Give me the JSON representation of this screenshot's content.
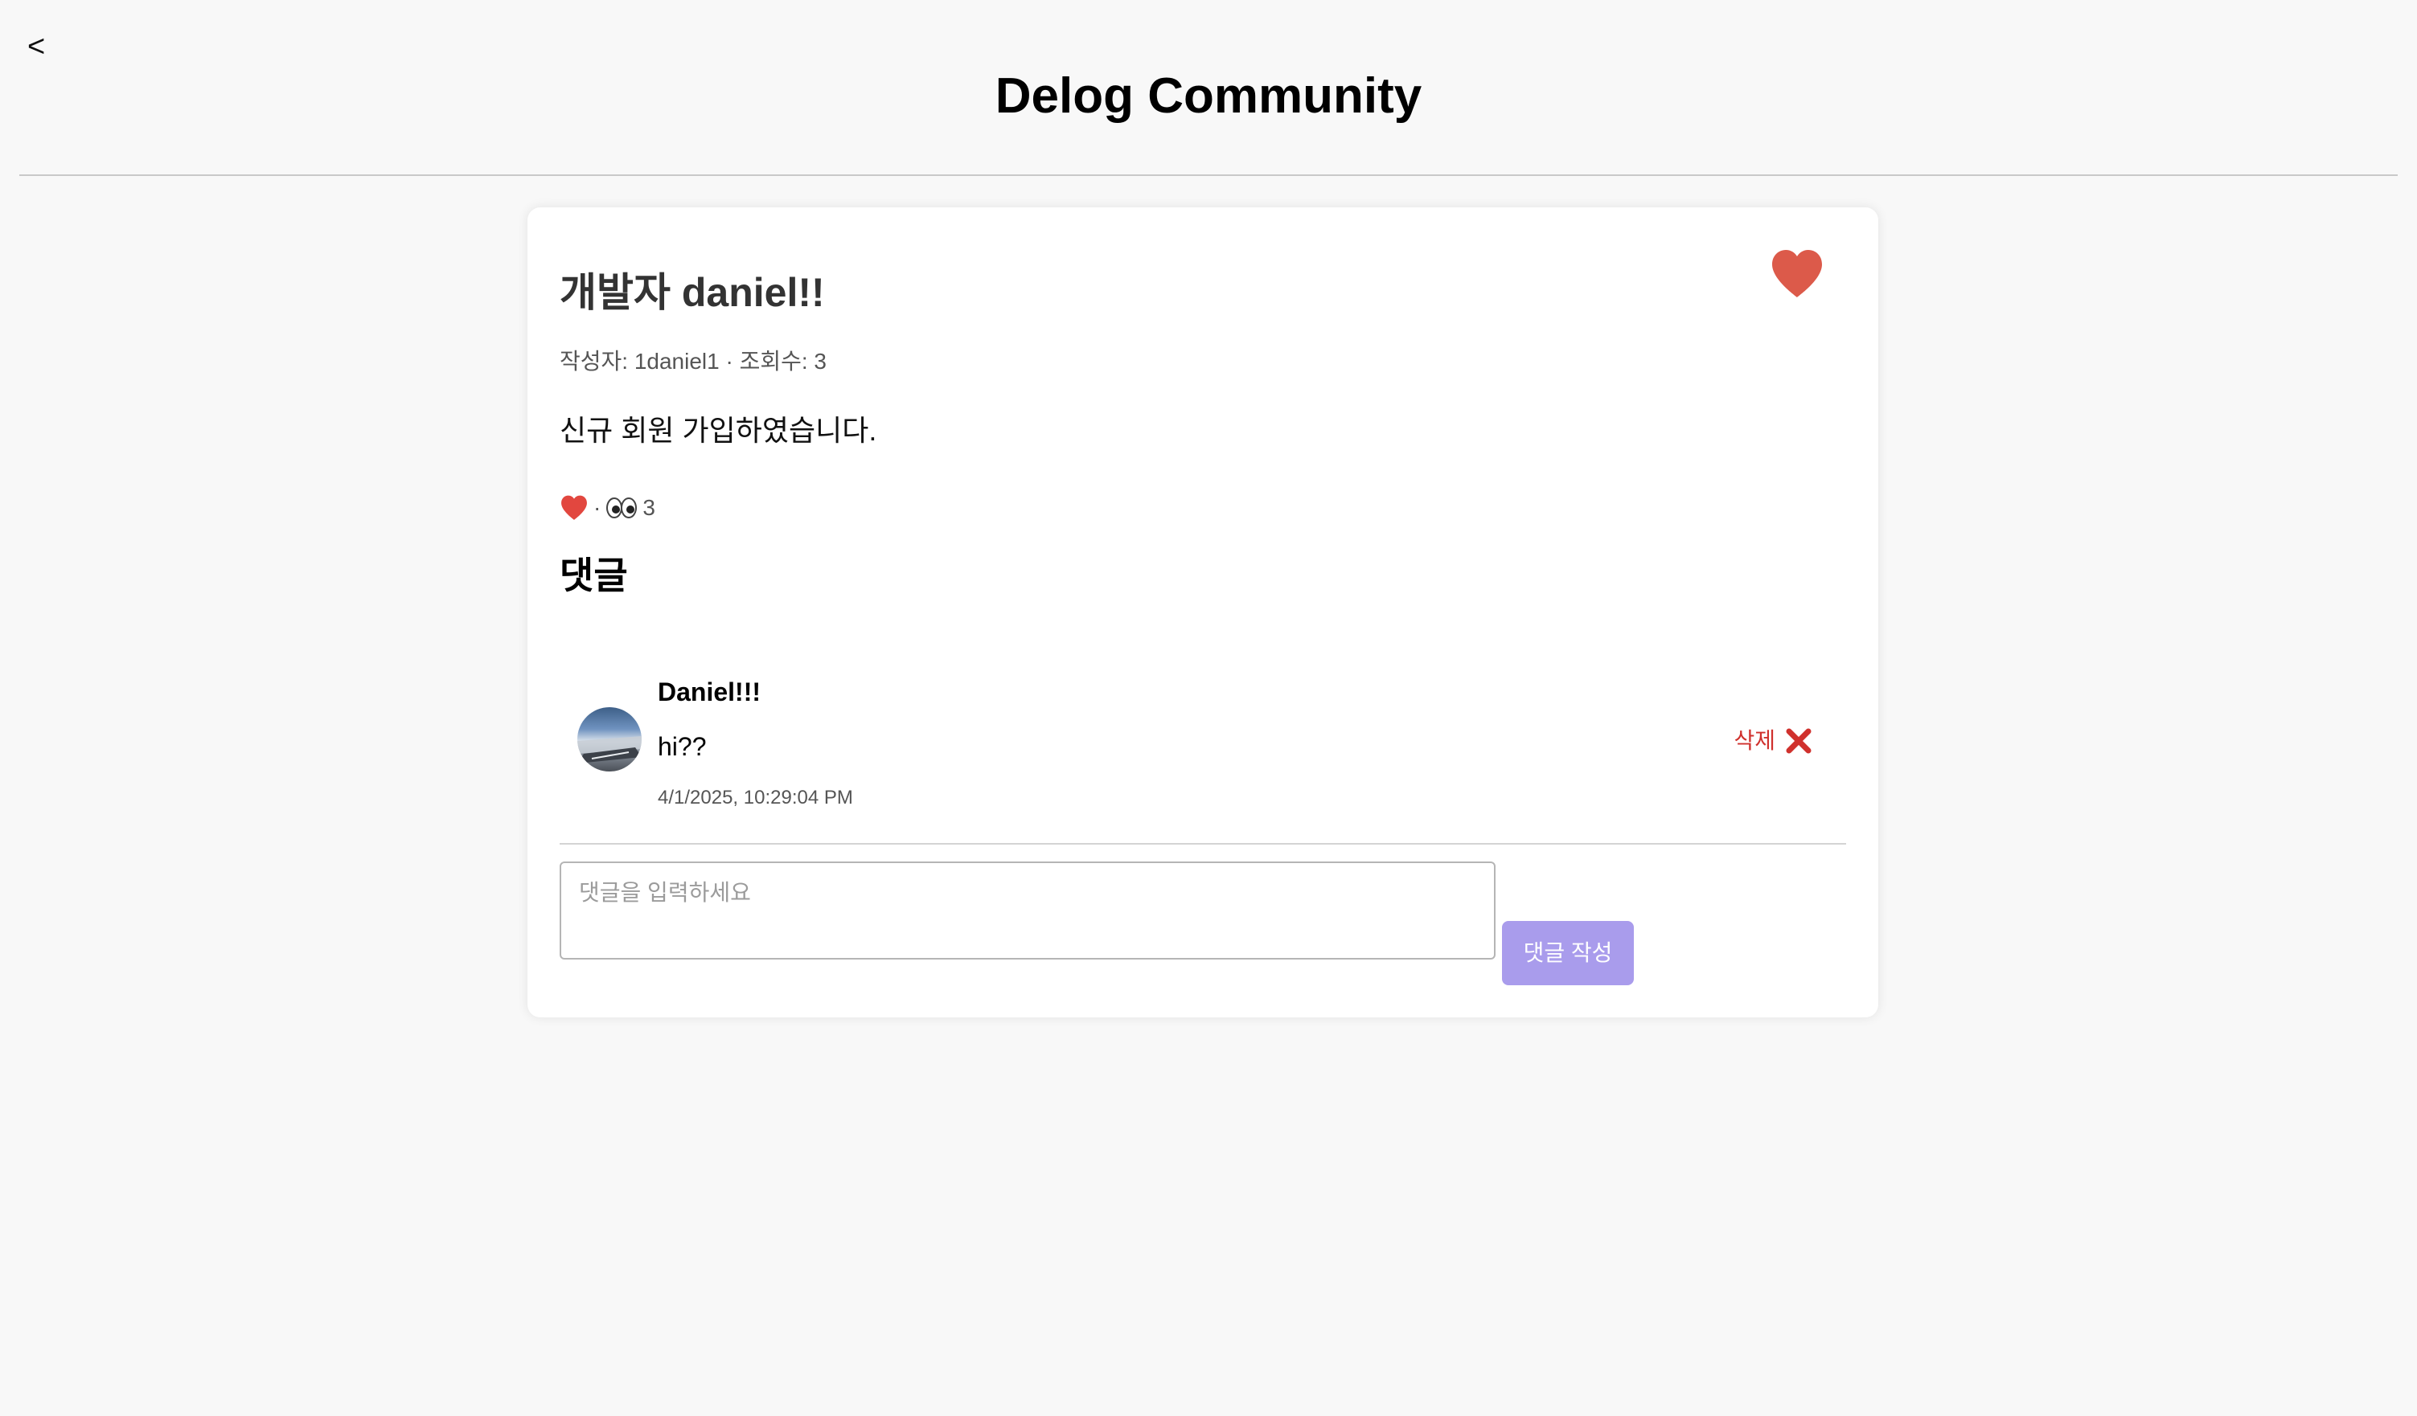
{
  "header": {
    "back_label": "<",
    "title": "Delog Community"
  },
  "post": {
    "title": "개발자 daniel!!",
    "meta": "작성자: 1daniel1 · 조회수: 3",
    "body": "신규 회원 가입하였습니다.",
    "stats": {
      "separator": "·",
      "views": "3"
    },
    "liked": true
  },
  "comments": {
    "heading": "댓글",
    "items": [
      {
        "author": "Daniel!!!",
        "text": "hi??",
        "timestamp": "4/1/2025, 10:29:04 PM",
        "delete_label": "삭제"
      }
    ],
    "input": {
      "placeholder": "댓글을 입력하세요",
      "value": ""
    },
    "submit_label": "댓글 작성"
  },
  "icons": {
    "back": "chevron-left-icon",
    "like": "heart-icon",
    "views": "eyes-icon",
    "delete": "close-icon"
  },
  "colors": {
    "background": "#f8f8f8",
    "card": "#ffffff",
    "heart": "#dc5a4a",
    "delete": "#d0312d",
    "submit_button": "#a99cec"
  }
}
